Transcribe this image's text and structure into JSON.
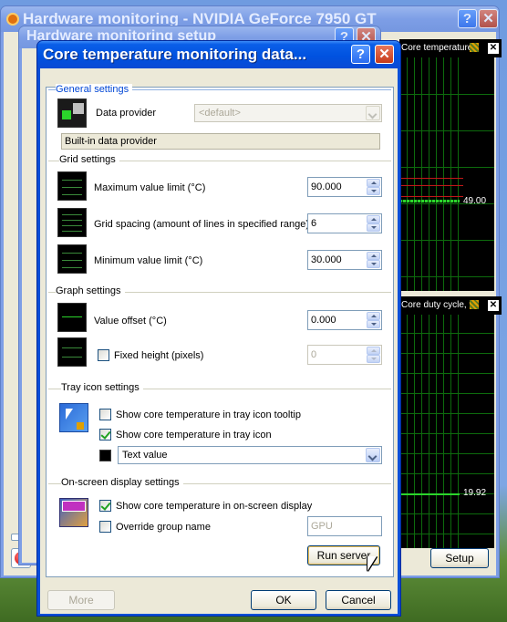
{
  "window_main": {
    "title": "Hardware monitoring - NVIDIA GeForce 7950 GT",
    "graph1_title": "Core temperature, °C",
    "graph1_value": "49.00",
    "graph2_title": "Core duty cycle, %",
    "graph2_value": "19.92",
    "setup_button": "Setup",
    "help_glyph": "?",
    "close_glyph": "✕"
  },
  "window_setup": {
    "title": "Hardware monitoring setup"
  },
  "dialog": {
    "title": "Core temperature monitoring data...",
    "general": {
      "heading": "General settings",
      "data_provider_label": "Data provider",
      "data_provider_value": "<default>",
      "provider_description": "Built-in data provider"
    },
    "grid": {
      "heading": "Grid settings",
      "max_label": "Maximum value limit (°C)",
      "max_value": "90.000",
      "spacing_label": "Grid spacing (amount of lines in specified range)",
      "spacing_value": "6",
      "min_label": "Minimum value limit (°C)",
      "min_value": "30.000"
    },
    "graph": {
      "heading": "Graph settings",
      "offset_label": "Value offset (°C)",
      "offset_value": "0.000",
      "fixed_height_label": "Fixed height (pixels)",
      "fixed_height_checked": false,
      "fixed_height_value": "0"
    },
    "tray": {
      "heading": "Tray icon settings",
      "tooltip_label": "Show core temperature in tray icon tooltip",
      "tooltip_checked": false,
      "icon_label": "Show core temperature in tray icon",
      "icon_checked": true,
      "mode_value": "Text value",
      "swatch_color": "#000000"
    },
    "osd": {
      "heading": "On-screen display settings",
      "show_label": "Show core temperature in on-screen display",
      "show_checked": true,
      "override_label": "Override group name",
      "override_checked": false,
      "group_value": "GPU",
      "run_server_button": "Run server"
    },
    "buttons": {
      "more": "More",
      "ok": "OK",
      "cancel": "Cancel"
    }
  },
  "colors": {
    "xp_title_blue": "#0052e0",
    "dialog_face": "#ece9d8",
    "graph_grid": "#0d6b0d",
    "graph_line": "#2bd42b",
    "graph_limit": "#c01818"
  }
}
